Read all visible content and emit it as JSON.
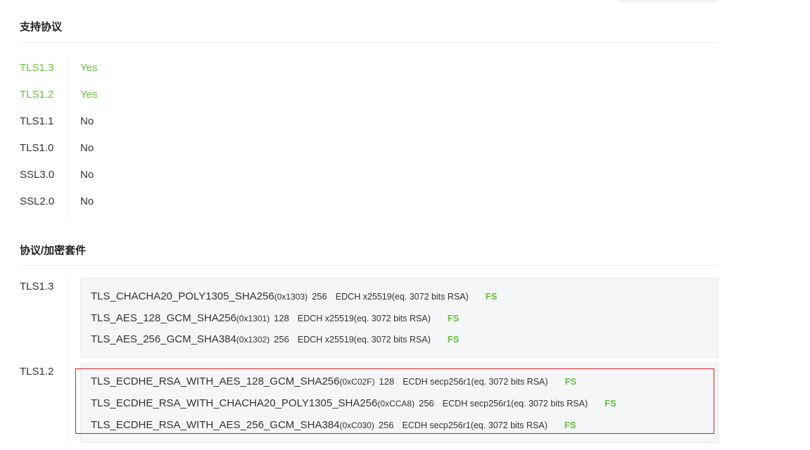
{
  "sections": {
    "protocols_title": "支持协议",
    "suites_title": "协议/加密套件"
  },
  "protocols": [
    {
      "name": "TLS1.3",
      "value": "Yes",
      "supported": true
    },
    {
      "name": "TLS1.2",
      "value": "Yes",
      "supported": true
    },
    {
      "name": "TLS1.1",
      "value": "No",
      "supported": false
    },
    {
      "name": "TLS1.0",
      "value": "No",
      "supported": false
    },
    {
      "name": "SSL3.0",
      "value": "No",
      "supported": false
    },
    {
      "name": "SSL2.0",
      "value": "No",
      "supported": false
    }
  ],
  "suite_groups": [
    {
      "protocol": "TLS1.3",
      "suites": [
        {
          "name": "TLS_CHACHA20_POLY1305_SHA256",
          "code": "(0x1303)",
          "bits": "256",
          "kex": "EDCH x25519(eq. 3072 bits RSA)",
          "fs": "FS"
        },
        {
          "name": "TLS_AES_128_GCM_SHA256",
          "code": "(0x1301)",
          "bits": "128",
          "kex": "EDCH x25519(eq. 3072 bits RSA)",
          "fs": "FS"
        },
        {
          "name": "TLS_AES_256_GCM_SHA384",
          "code": "(0x1302)",
          "bits": "256",
          "kex": "EDCH x25519(eq. 3072 bits RSA)",
          "fs": "FS"
        }
      ]
    },
    {
      "protocol": "TLS1.2",
      "suites": [
        {
          "name": "TLS_ECDHE_RSA_WITH_AES_128_GCM_SHA256",
          "code": "(0xC02F)",
          "bits": "128",
          "kex": "ECDH secp256r1(eq. 3072 bits RSA)",
          "fs": "FS"
        },
        {
          "name": "TLS_ECDHE_RSA_WITH_CHACHA20_POLY1305_SHA256",
          "code": "(0xCCA8)",
          "bits": "256",
          "kex": "ECDH secp256r1(eq. 3072 bits RSA)",
          "fs": "FS"
        },
        {
          "name": "TLS_ECDHE_RSA_WITH_AES_256_GCM_SHA384",
          "code": "(0xC030)",
          "bits": "256",
          "kex": "ECDH secp256r1(eq. 3072 bits RSA)",
          "fs": "FS"
        }
      ]
    }
  ],
  "colors": {
    "supported": "#67c23a",
    "fs_badge": "#67c23a",
    "highlight": "#e02020",
    "suite_box_bg": "#f5f6f8"
  }
}
